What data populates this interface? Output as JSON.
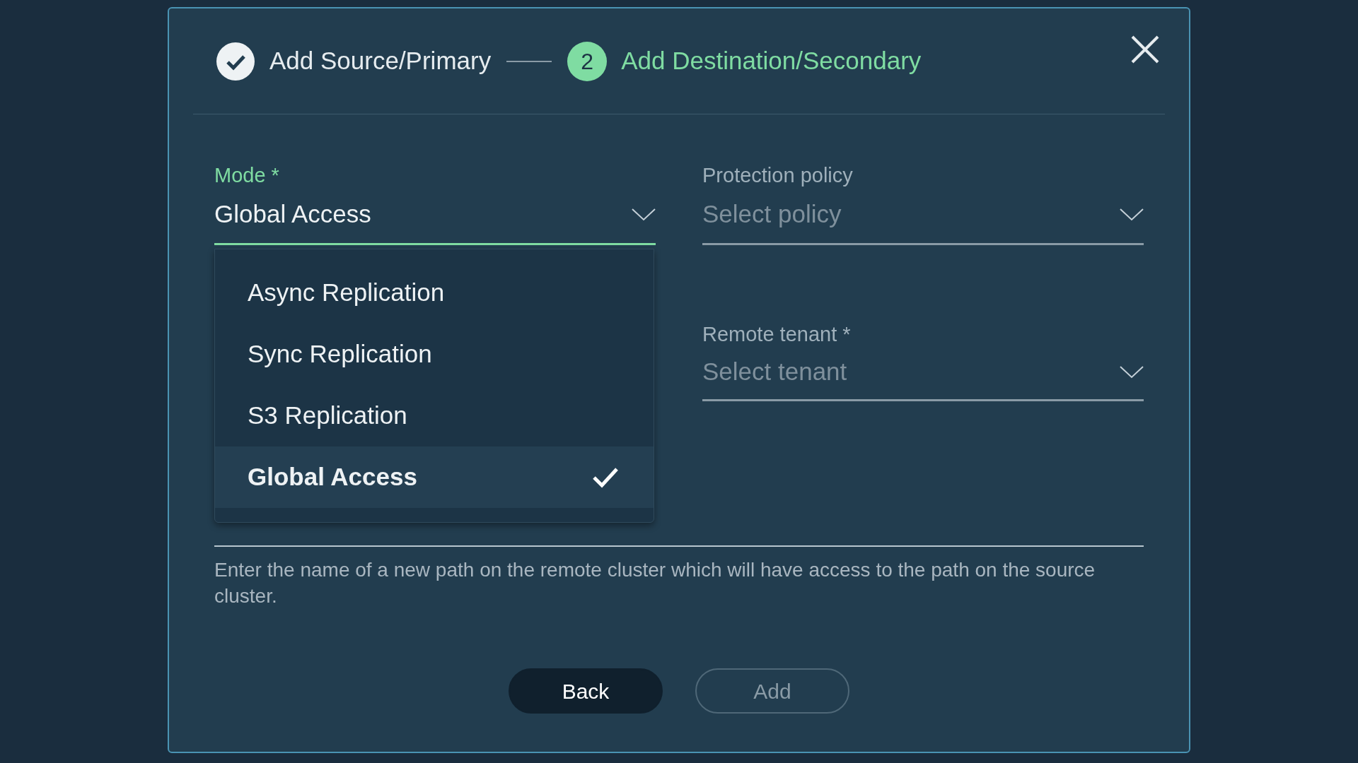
{
  "stepper": [
    {
      "label": "Add Source/Primary",
      "done": true,
      "selected": false
    },
    {
      "label": "Add Destination/Secondary",
      "number": "2",
      "done": false,
      "selected": true
    }
  ],
  "mode": {
    "label": "Mode *",
    "value": "Global Access",
    "expanded": true,
    "options": [
      {
        "label": "Async Replication",
        "selected": false
      },
      {
        "label": "Sync Replication",
        "selected": false
      },
      {
        "label": "S3 Replication",
        "selected": false
      },
      {
        "label": "Global Access",
        "selected": true
      }
    ]
  },
  "protection_policy": {
    "label": "Protection policy",
    "placeholder": "Select policy"
  },
  "remote_tenant": {
    "label": "Remote tenant *",
    "placeholder": "Select tenant"
  },
  "remote_path": {
    "help": "Enter the name of a new path on the remote cluster which will have access to the path on the source cluster."
  },
  "buttons": [
    {
      "label": "Back",
      "disabled": false
    },
    {
      "label": "Add",
      "disabled": true
    }
  ]
}
